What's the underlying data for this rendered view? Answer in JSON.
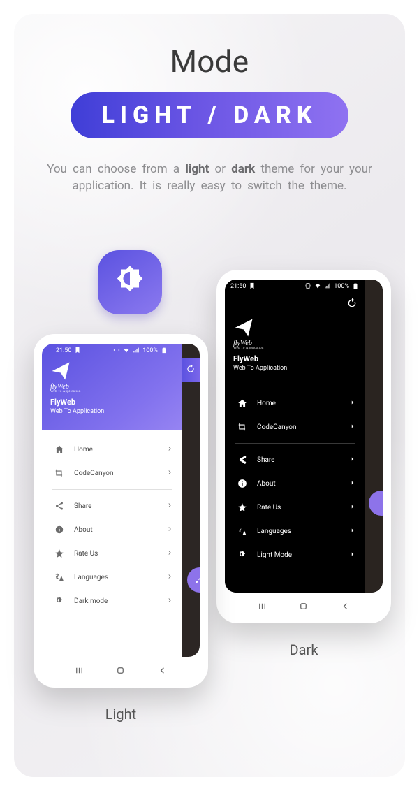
{
  "header": {
    "title": "Mode",
    "pill": "LIGHT / DARK"
  },
  "description": {
    "pre": "You can choose from a ",
    "light_word": "light",
    "mid": " or ",
    "dark_word": "dark",
    "post": " theme for your your application. It is really easy to switch the theme."
  },
  "status": {
    "time": "21:50",
    "battery_pct": "100%"
  },
  "app": {
    "brand": "flyWeb",
    "brand_tag": "Web To Application",
    "title": "FlyWeb",
    "subtitle": "Web To Application"
  },
  "menu": {
    "home": "Home",
    "codecanyon": "CodeCanyon",
    "share": "Share",
    "about": "About",
    "rate": "Rate Us",
    "languages": "Languages",
    "dark_mode": "Dark mode",
    "light_mode": "Light Mode"
  },
  "captions": {
    "light": "Light",
    "dark": "Dark"
  },
  "icons": {
    "brightness": "brightness-icon",
    "refresh": "refresh-icon",
    "home": "home-icon",
    "code": "crop-icon",
    "share": "share-icon",
    "info": "info-icon",
    "star": "star-icon",
    "translate": "translate-icon",
    "theme": "brightness-icon",
    "brush": "brush-icon"
  }
}
